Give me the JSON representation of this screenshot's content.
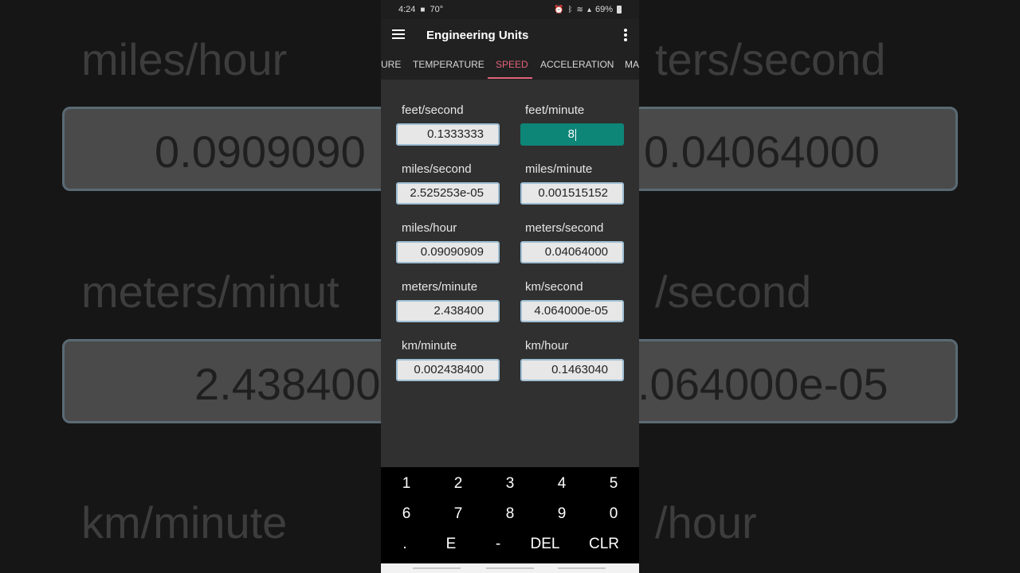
{
  "status": {
    "time": "4:24",
    "temperature": "70°",
    "battery": "69%"
  },
  "app": {
    "title": "Engineering Units"
  },
  "tabs": [
    {
      "label": "URE"
    },
    {
      "label": "TEMPERATURE"
    },
    {
      "label": "SPEED"
    },
    {
      "label": "ACCELERATION"
    },
    {
      "label": "MA"
    }
  ],
  "active_tab": "SPEED",
  "fields": [
    {
      "label": "feet/second",
      "value": "0.1333333"
    },
    {
      "label": "feet/minute",
      "value": "8"
    },
    {
      "label": "miles/second",
      "value": "2.525253e-05"
    },
    {
      "label": "miles/minute",
      "value": "0.001515152"
    },
    {
      "label": "miles/hour",
      "value": "0.09090909"
    },
    {
      "label": "meters/second",
      "value": "0.04064000"
    },
    {
      "label": "meters/minute",
      "value": "2.438400"
    },
    {
      "label": "km/second",
      "value": "4.064000e-05"
    },
    {
      "label": "km/minute",
      "value": "0.002438400"
    },
    {
      "label": "km/hour",
      "value": "0.1463040"
    }
  ],
  "keypad": {
    "row1": [
      "1",
      "2",
      "3",
      "4",
      "5"
    ],
    "row2": [
      "6",
      "7",
      "8",
      "9",
      "0"
    ],
    "row3": [
      ".",
      "E",
      "-",
      "DEL",
      "CLR"
    ]
  },
  "background": {
    "labels": [
      "miles/hour",
      "ters/second",
      "meters/minut",
      "/second",
      "km/minute",
      "/hour"
    ],
    "values": [
      "0.0909090",
      "0.04064000",
      "2.438400",
      ".064000e-05"
    ]
  },
  "colors": {
    "accent_tab": "#e0637a",
    "active_field": "#0d8577",
    "field_border": "#9fbfd4",
    "surface": "#303030",
    "appbar": "#212121"
  }
}
